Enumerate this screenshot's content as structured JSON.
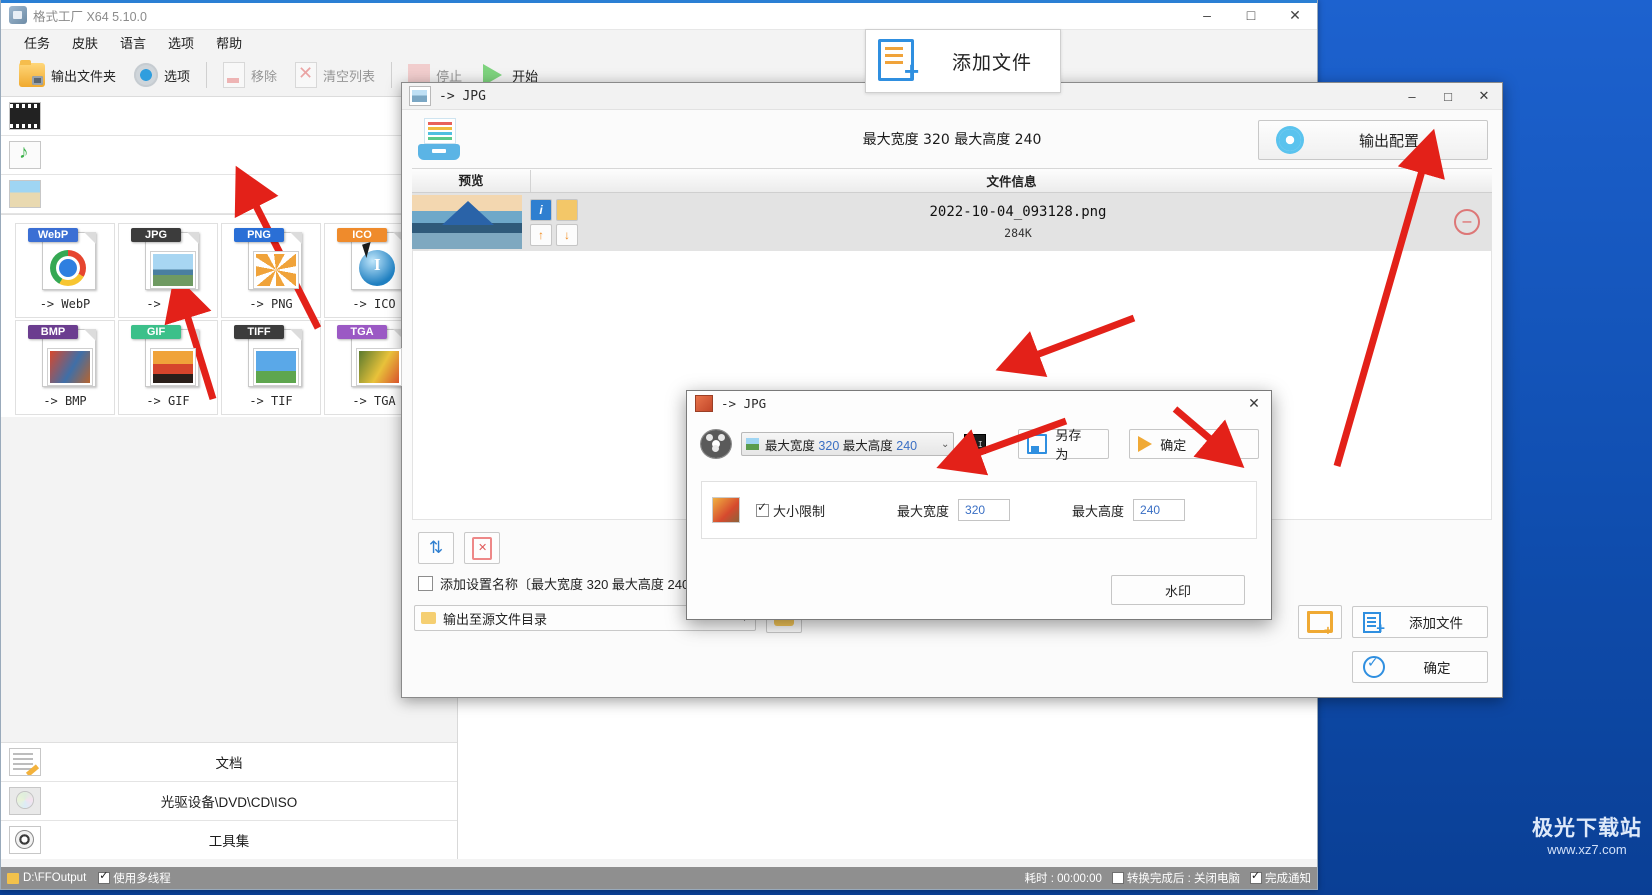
{
  "app": {
    "title": "格式工厂 X64 5.10.0",
    "window_buttons": {
      "minimize": "–",
      "maximize": "□",
      "close": "✕"
    },
    "menu": [
      "任务",
      "皮肤",
      "语言",
      "选项",
      "帮助"
    ],
    "toolbar": [
      {
        "label": "输出文件夹",
        "icon": "output-folder-icon",
        "disabled": false
      },
      {
        "label": "选项",
        "icon": "options-gear-icon",
        "disabled": false
      },
      {
        "label": "移除",
        "icon": "remove-page-icon",
        "disabled": true
      },
      {
        "label": "清空列表",
        "icon": "clear-list-icon",
        "disabled": true
      },
      {
        "label": "停止",
        "icon": "stop-icon",
        "disabled": true
      },
      {
        "label": "开始",
        "icon": "play-icon",
        "disabled": false
      }
    ],
    "categories_top": [
      {
        "label": "视频",
        "icon": "video-icon"
      },
      {
        "label": "音频",
        "icon": "audio-icon"
      },
      {
        "label": "图片",
        "icon": "image-icon"
      }
    ],
    "categories_bottom": [
      {
        "label": "文档",
        "icon": "document-icon"
      },
      {
        "label": "光驱设备\\DVD\\CD\\ISO",
        "icon": "disc-drive-icon"
      },
      {
        "label": "工具集",
        "icon": "toolset-icon"
      }
    ],
    "format_tiles": [
      {
        "badge": "WebP",
        "caption": "-> WebP",
        "badge_color": "#3b6fd4",
        "glyph": "chrome"
      },
      {
        "badge": "JPG",
        "caption": "-> JPG",
        "badge_color": "#3c3c3c",
        "glyph": "photo-lake"
      },
      {
        "badge": "PNG",
        "caption": "-> PNG",
        "badge_color": "#2a6fd6",
        "glyph": "photo-flower"
      },
      {
        "badge": "ICO",
        "caption": "-> ICO",
        "badge_color": "#ef8b2c",
        "glyph": "ico-ball"
      },
      {
        "badge": "BMP",
        "caption": "-> BMP",
        "badge_color": "#6b3d8f",
        "glyph": "photo-paint"
      },
      {
        "badge": "GIF",
        "caption": "-> GIF",
        "badge_color": "#3cc08a",
        "glyph": "photo-sunset"
      },
      {
        "badge": "TIFF",
        "caption": "-> TIF",
        "badge_color": "#3c3c3c",
        "glyph": "photo-sky"
      },
      {
        "badge": "TGA",
        "caption": "-> TGA",
        "badge_color": "#9b59c4",
        "glyph": "photo-bloom"
      }
    ],
    "statusbar": {
      "output_path": "D:\\FFOutput",
      "multithread_label": "使用多线程",
      "multithread_checked": true,
      "elapsed_label": "耗时 : 00:00:00",
      "after_convert_label": "转换完成后 : 关闭电脑",
      "after_convert_checked": false,
      "notify_label": "完成通知",
      "notify_checked": true
    }
  },
  "jpg_dialog": {
    "title": "-> JPG",
    "window_buttons": {
      "minimize": "–",
      "maximize": "□",
      "close": "✕"
    },
    "header_summary": "最大宽度 320 最大高度 240",
    "output_config_label": "输出配置",
    "list_headers": {
      "preview": "预览",
      "file_info": "文件信息"
    },
    "files": [
      {
        "name": "2022-10-04_093128.png",
        "size": "284K"
      }
    ],
    "row_buttons": {
      "info": "i",
      "folder": "",
      "move_up": "↑",
      "move_down": "↓",
      "remove": "⊖"
    },
    "add_file_big_label": "添加文件",
    "bottom_tool_buttons": [
      {
        "name": "sort-button",
        "glyph": "↓↑"
      },
      {
        "name": "clear-list-button",
        "glyph": "✕"
      }
    ],
    "add_setting_name": {
      "label": "添加设置名称〔最大宽度 320 最大高度 240〕",
      "checked": false
    },
    "output_dir": {
      "value": "输出至源文件目录",
      "caret": "▼"
    },
    "browse_button": "folder-browse-icon",
    "new_folder_button": "new-folder-icon",
    "add_file_label": "添加文件",
    "ok_label": "确定"
  },
  "settings_dialog": {
    "title": "-> JPG",
    "close": "✕",
    "preset": {
      "label_prefix": "最大宽度",
      "width": "320",
      "label_mid": "最大高度",
      "height": "240",
      "caret": "⌄"
    },
    "cli_button": "CLI",
    "save_as_label": "另存为",
    "confirm_label": "确定",
    "size_limit": {
      "label": "大小限制",
      "checked": true,
      "max_width_label": "最大宽度",
      "max_width": "320",
      "max_height_label": "最大高度",
      "max_height": "240"
    },
    "watermark_label": "水印"
  },
  "watermark": {
    "brand": "极光下载站",
    "site": "www.xz7.com"
  },
  "colors": {
    "accent_blue": "#2f8fe0",
    "arrow_red": "#e32119",
    "desktop_blue": "#1559c4",
    "statusbar_gray": "#8f8f8f"
  }
}
